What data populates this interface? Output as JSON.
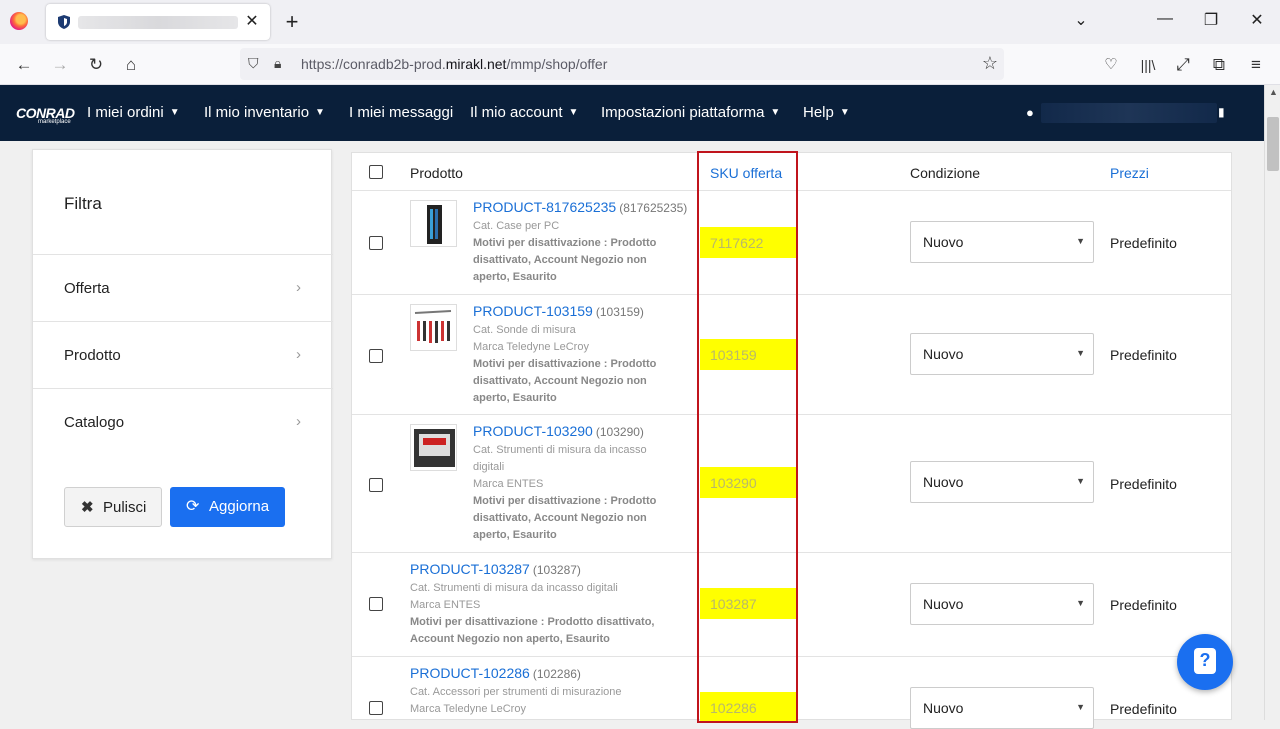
{
  "browser": {
    "tab_close": "✕",
    "new_tab": "+",
    "url_prefix": "https://conradb2b-prod.",
    "url_domain": "mirakl.net",
    "url_suffix": "/mmp/shop/offer"
  },
  "appbar": {
    "brand": "CONRAD",
    "brand_sub": "marketplace",
    "menus": [
      {
        "label": "I miei ordini",
        "caret": "▼"
      },
      {
        "label": "Il mio inventario",
        "caret": "▼"
      },
      {
        "label": "I miei messaggi",
        "caret": ""
      },
      {
        "label": "Il mio account",
        "caret": "▼"
      },
      {
        "label": "Impostazioni piattaforma",
        "caret": "▼"
      },
      {
        "label": "Help",
        "caret": "▼"
      }
    ]
  },
  "filter": {
    "title": "Filtra",
    "sections": [
      "Offerta",
      "Prodotto",
      "Catalogo"
    ],
    "clear_label": "Pulisci",
    "refresh_label": "Aggiorna"
  },
  "table": {
    "headers": {
      "product": "Prodotto",
      "sku": "SKU offerta",
      "condition": "Condizione",
      "prices": "Prezzi"
    },
    "rows": [
      {
        "name": "PRODUCT-817625235",
        "id": "(817625235)",
        "category": "Cat. Case per PC",
        "brand": "",
        "reason_lines": [
          "Motivi per disattivazione : Prodotto",
          "disattivato, Account Negozio non",
          "aperto, Esaurito"
        ],
        "sku": "7117622",
        "condition": "Nuovo",
        "price": "Predefinito"
      },
      {
        "name": "PRODUCT-103159",
        "id": "(103159)",
        "category": "Cat. Sonde di misura",
        "brand": "Marca Teledyne LeCroy",
        "reason_lines": [
          "Motivi per disattivazione : Prodotto",
          "disattivato, Account Negozio non",
          "aperto, Esaurito"
        ],
        "sku": "103159",
        "condition": "Nuovo",
        "price": "Predefinito"
      },
      {
        "name": "PRODUCT-103290",
        "id": "(103290)",
        "category_lines": [
          "Cat. Strumenti di misura da incasso",
          "digitali"
        ],
        "brand": "Marca ENTES",
        "reason_lines": [
          "Motivi per disattivazione : Prodotto",
          "disattivato, Account Negozio non",
          "aperto, Esaurito"
        ],
        "sku": "103290",
        "condition": "Nuovo",
        "price": "Predefinito"
      },
      {
        "name": "PRODUCT-103287",
        "id": "(103287)",
        "category": "Cat. Strumenti di misura da incasso digitali",
        "brand": "Marca ENTES",
        "reason_lines": [
          "Motivi per disattivazione : Prodotto disattivato,",
          "Account Negozio non aperto, Esaurito"
        ],
        "sku": "103287",
        "condition": "Nuovo",
        "price": "Predefinito"
      },
      {
        "name": "PRODUCT-102286",
        "id": "(102286)",
        "category": "Cat. Accessori per strumenti di misurazione",
        "brand": "Marca Teledyne LeCroy",
        "sku": "102286",
        "condition": "Nuovo",
        "price": "Predefinito"
      }
    ]
  },
  "colors": {
    "appbar": "#0a1f3a",
    "link": "#1a6fd6",
    "primary_button": "#1a6ff0",
    "highlight": "#ffff00",
    "annotation_box": "#c0141c"
  }
}
